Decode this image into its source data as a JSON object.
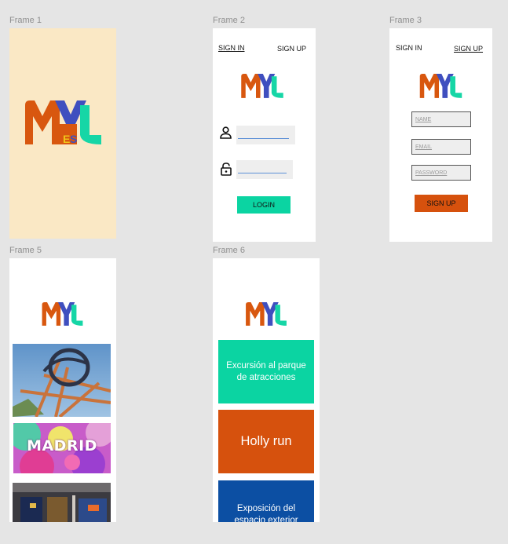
{
  "frames": {
    "f1": "Frame 1",
    "f2": "Frame 2",
    "f3": "Frame 3",
    "f5": "Frame 5",
    "f6": "Frame 6"
  },
  "colors": {
    "canvas": "#e5e5e5",
    "splash_bg": "#fae8c5",
    "teal": "#0bd4a2",
    "orange": "#d6510d",
    "blue": "#0c4fa3",
    "logo_orange": "#d8570f",
    "logo_blue": "#3f4fbf",
    "logo_teal": "#16d6a6",
    "logo_yellow": "#f0c419"
  },
  "login_screen": {
    "tab_sign_in": "SIGN IN",
    "tab_sign_up": "SIGN UP",
    "user_icon": "user-icon",
    "lock_icon": "lock-icon",
    "login_button": "LOGIN"
  },
  "signup_screen": {
    "tab_sign_in": "SIGN IN",
    "tab_sign_up": "SIGN UP",
    "name_placeholder": "NAME",
    "email_placeholder": "EMAIL",
    "password_placeholder": "PASSWORD",
    "signup_button": "SIGN UP"
  },
  "gallery_screen": {
    "madrid_text": "MADRID"
  },
  "events_screen": {
    "events": [
      "Excursión al parque de atracciones",
      "Holly run",
      "Exposición del espacio exterior"
    ]
  }
}
